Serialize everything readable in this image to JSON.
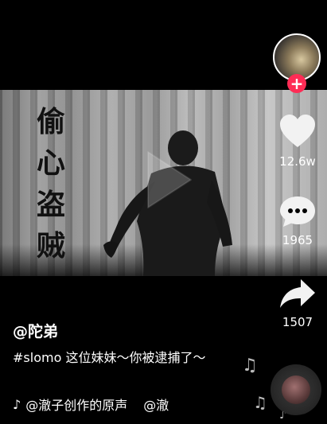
{
  "video": {
    "calligraphy": [
      "偷",
      "心",
      "盗",
      "贼"
    ]
  },
  "sidebar": {
    "like_count": "12.6w",
    "comment_count": "1965",
    "share_count": "1507",
    "follow_label": "+"
  },
  "post": {
    "author": "@陀弟",
    "caption": "#slomo 这位妹妹～你被逮捕了～",
    "music_sound": "@澈子创作的原声",
    "music_author": "@澈"
  },
  "icons": {
    "like": "heart-icon",
    "comment": "comment-icon",
    "share": "share-arrow-icon",
    "music": "tiktok-note-icon",
    "play": "play-icon",
    "disc": "music-disc-icon"
  }
}
